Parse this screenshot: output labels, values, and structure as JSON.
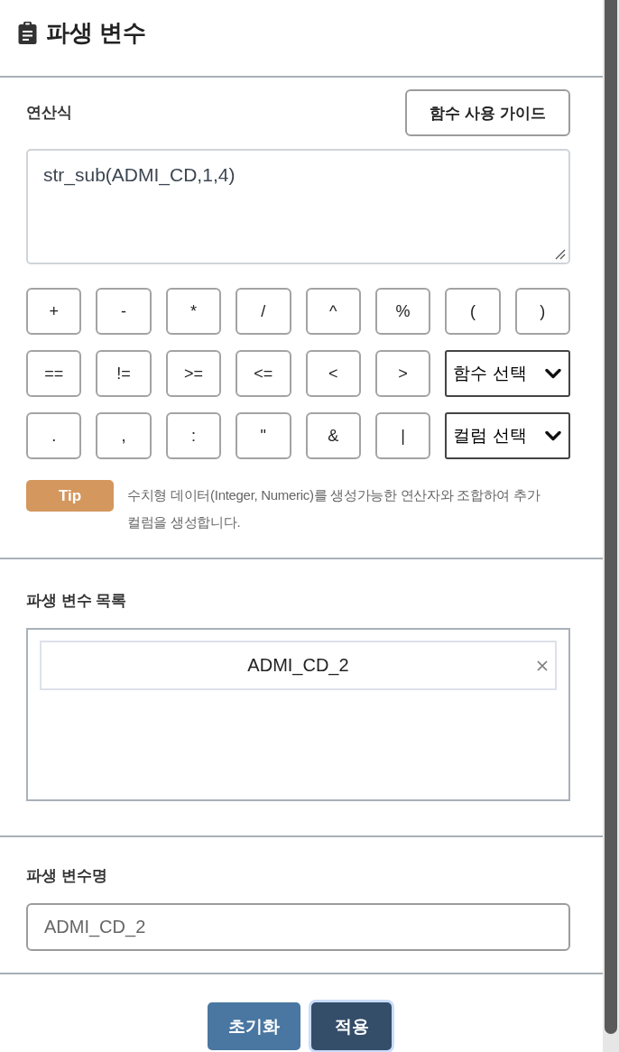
{
  "header": {
    "title": "파생 변수"
  },
  "expression": {
    "label": "연산식",
    "guide_button": "함수 사용 가이드",
    "value": "str_sub(ADMI_CD,1,4)"
  },
  "operator_rows": [
    {
      "items": [
        {
          "kind": "key",
          "label": "+"
        },
        {
          "kind": "key",
          "label": "-"
        },
        {
          "kind": "key",
          "label": "*"
        },
        {
          "kind": "key",
          "label": "/"
        },
        {
          "kind": "key",
          "label": "^"
        },
        {
          "kind": "key",
          "label": "%"
        },
        {
          "kind": "key",
          "label": "("
        },
        {
          "kind": "key",
          "label": ")"
        }
      ]
    },
    {
      "items": [
        {
          "kind": "key",
          "label": "=="
        },
        {
          "kind": "key",
          "label": "!="
        },
        {
          "kind": "key",
          "label": ">="
        },
        {
          "kind": "key",
          "label": "<="
        },
        {
          "kind": "key",
          "label": "<"
        },
        {
          "kind": "key",
          "label": ">"
        },
        {
          "kind": "select",
          "label": "함수 선택"
        }
      ]
    },
    {
      "items": [
        {
          "kind": "key",
          "label": "."
        },
        {
          "kind": "key",
          "label": ","
        },
        {
          "kind": "key",
          "label": ":"
        },
        {
          "kind": "key",
          "label": "\""
        },
        {
          "kind": "key",
          "label": "&"
        },
        {
          "kind": "key",
          "label": "|"
        },
        {
          "kind": "select",
          "label": "컬럼 선택"
        }
      ]
    }
  ],
  "tip": {
    "badge": "Tip",
    "text": "수치형 데이터(Integer, Numeric)를 생성가능한 연산자와 조합하여 추가 컬럼을 생성합니다."
  },
  "derived_list": {
    "label": "파생 변수 목록",
    "items": [
      {
        "name": "ADMI_CD_2"
      }
    ]
  },
  "name_field": {
    "label": "파생 변수명",
    "value": "ADMI_CD_2"
  },
  "footer": {
    "buttons": [
      {
        "label": "초기화",
        "kind": "secondary",
        "focused": false
      },
      {
        "label": "적용",
        "kind": "primary",
        "focused": true
      }
    ]
  }
}
